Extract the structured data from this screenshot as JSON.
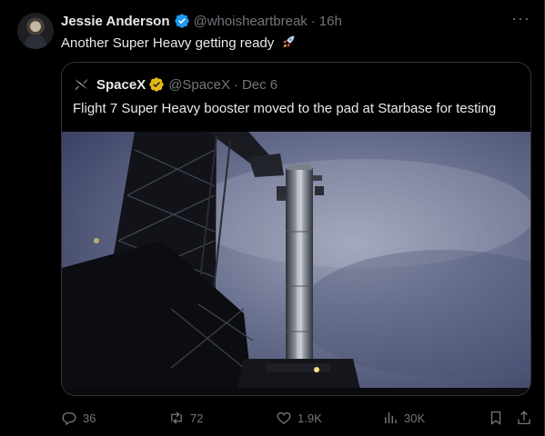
{
  "tweet": {
    "author_name": "Jessie Anderson",
    "handle": "@whoisheartbreak",
    "separator": "·",
    "time": "16h",
    "text": "Another Super Heavy getting ready"
  },
  "quoted": {
    "author_name": "SpaceX",
    "handle": "@SpaceX",
    "separator": "·",
    "date": "Dec 6",
    "text": "Flight 7 Super Heavy booster moved to the pad at Starbase for testing"
  },
  "actions": {
    "replies": "36",
    "reposts": "72",
    "likes": "1.9K",
    "views": "30K"
  },
  "icons": [
    "verified-badge-icon",
    "more-icon",
    "rocket-emoji-icon",
    "x-logo-icon",
    "gold-verified-badge-icon",
    "reply-icon",
    "repost-icon",
    "like-icon",
    "views-icon",
    "bookmark-icon",
    "share-icon"
  ],
  "colors": {
    "verified_blue": "#1d9bf0",
    "gold_badge": "#e2b719",
    "muted": "#71767b",
    "text": "#e7e9ea"
  }
}
